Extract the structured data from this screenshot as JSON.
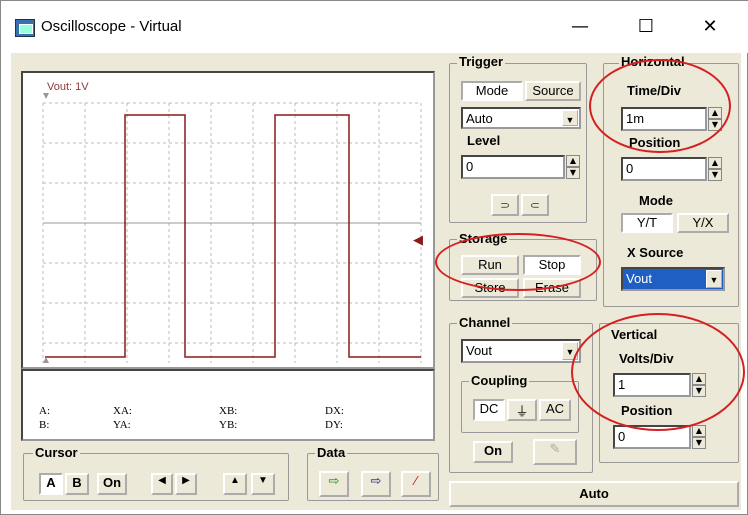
{
  "window": {
    "title": "Oscilloscope - Virtual",
    "minimize": "—",
    "maximize": "☐",
    "close": "✕"
  },
  "scope": {
    "channel_label": "Vout: 1V"
  },
  "readout": {
    "a": "A:",
    "b": "B:",
    "xa": "XA:",
    "ya": "YA:",
    "xb": "XB:",
    "yb": "YB:",
    "dx": "DX:",
    "dy": "DY:"
  },
  "trigger": {
    "title": "Trigger",
    "mode": "Mode",
    "source": "Source",
    "mode_value": "Auto",
    "level_label": "Level",
    "level_value": "0",
    "falling": "⸧",
    "rising": "⸦"
  },
  "horizontal": {
    "title": "Horizontal",
    "timediv_label": "Time/Div",
    "timediv_value": "1m",
    "position_label": "Position",
    "position_value": "0",
    "mode_label": "Mode",
    "yt": "Y/T",
    "yx": "Y/X",
    "xsource_label": "X Source",
    "xsource_value": "Vout"
  },
  "storage": {
    "title": "Storage",
    "run": "Run",
    "stop": "Stop",
    "store": "Store",
    "erase": "Erase"
  },
  "channel": {
    "title": "Channel",
    "value": "Vout",
    "coupling_label": "Coupling",
    "dc": "DC",
    "gnd": "⏚",
    "ac": "AC",
    "on": "On"
  },
  "vertical": {
    "title": "Vertical",
    "voltsdiv_label": "Volts/Div",
    "voltsdiv_value": "1",
    "position_label": "Position",
    "position_value": "0"
  },
  "cursor": {
    "title": "Cursor",
    "a": "A",
    "b": "B",
    "on": "On",
    "left": "◀",
    "right": "▶",
    "up": "▲",
    "down": "▼"
  },
  "data": {
    "title": "Data"
  },
  "auto": {
    "label": "Auto"
  },
  "colors": {
    "trace": "#8b1a1a",
    "annotation": "#d42020"
  }
}
